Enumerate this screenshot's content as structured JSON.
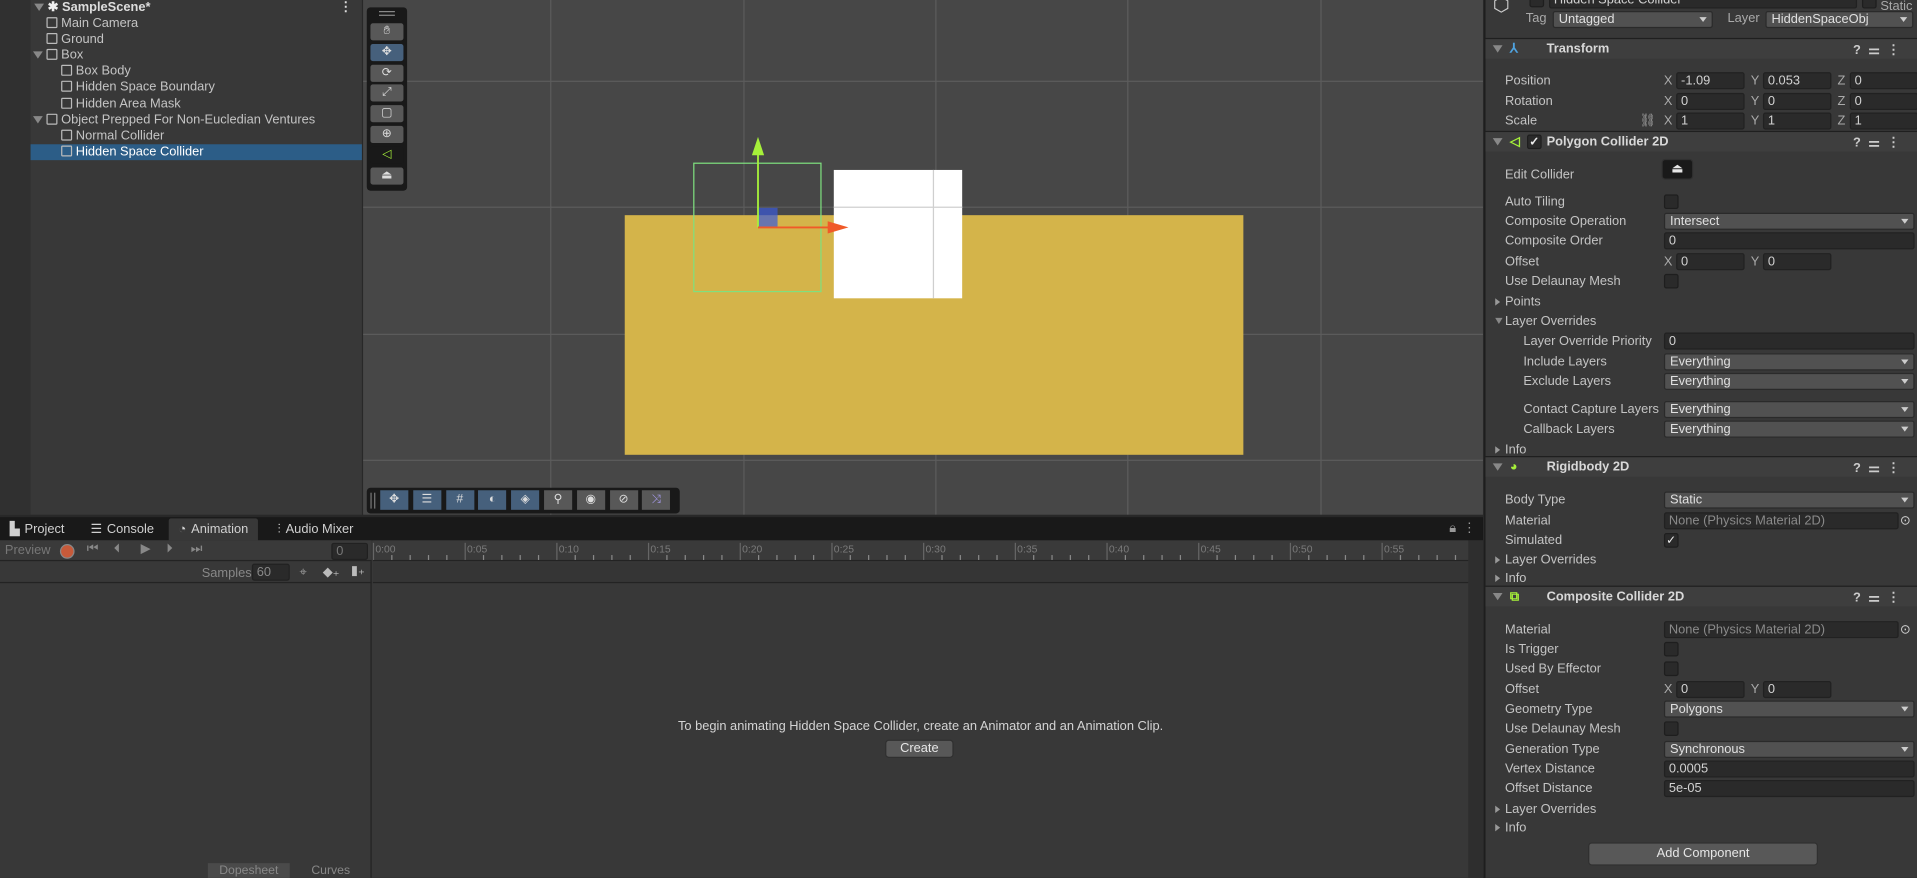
{
  "hierarchy": {
    "scene": "SampleScene*",
    "items": [
      {
        "label": "Main Camera",
        "depth": 1,
        "expanded": null
      },
      {
        "label": "Ground",
        "depth": 1,
        "expanded": null
      },
      {
        "label": "Box",
        "depth": 1,
        "expanded": true
      },
      {
        "label": "Box Body",
        "depth": 2,
        "expanded": null
      },
      {
        "label": "Hidden Space Boundary",
        "depth": 2,
        "expanded": null
      },
      {
        "label": "Hidden Area Mask",
        "depth": 2,
        "expanded": null
      },
      {
        "label": "Object Prepped For Non-Eucledian Ventures",
        "depth": 1,
        "expanded": true
      },
      {
        "label": "Normal Collider",
        "depth": 2,
        "expanded": null
      },
      {
        "label": "Hidden Space Collider",
        "depth": 2,
        "expanded": null,
        "selected": true
      }
    ]
  },
  "scene": {
    "tool_icons": [
      "hand-tool-icon",
      "move-tool-icon",
      "rotate-tool-icon",
      "scale-tool-icon",
      "rect-tool-icon",
      "transform-tool-icon",
      "edit-collider-tool-icon",
      "custom-tool-icon"
    ],
    "active_tool": "move-tool-icon",
    "overlay_icons": [
      "move-icon",
      "toolbar-settings-icon",
      "grid-icon",
      "lighting-icon",
      "gizmos-icon",
      "search-icon",
      "camera-visibility-icon",
      "orientation-icon",
      "fx-toggle-icon"
    ],
    "colors": {
      "ground": "#d4b44a",
      "box": "#ffffff",
      "collider_outline": "#7fe07f",
      "y_axis": "#a6f03a",
      "x_axis": "#f05a28"
    }
  },
  "bottom": {
    "tabs": [
      {
        "label": "Project",
        "icon": "folder-icon"
      },
      {
        "label": "Console",
        "icon": "console-icon"
      },
      {
        "label": "Animation",
        "icon": "clock-icon",
        "active": true
      },
      {
        "label": "Audio Mixer",
        "icon": "mixer-icon"
      }
    ],
    "preview_label": "Preview",
    "frame": "0",
    "samples_label": "Samples",
    "samples": "60",
    "timeline": [
      "0:00",
      "0:05",
      "0:10",
      "0:15",
      "0:20",
      "0:25",
      "0:30",
      "0:35",
      "0:40",
      "0:45",
      "0:50",
      "0:55"
    ],
    "message": "To begin animating Hidden Space Collider, create an Animator and an Animation Clip.",
    "create_label": "Create",
    "dopesheet_label": "Dopesheet",
    "curves_label": "Curves"
  },
  "inspector": {
    "object_name": "Hidden Space Collider",
    "static_label": "Static",
    "tag_label": "Tag",
    "tag": "Untagged",
    "layer_label": "Layer",
    "layer": "HiddenSpaceObj",
    "components": [
      {
        "title": "Transform",
        "icon": "transform-icon",
        "rows": [
          {
            "label": "Position",
            "kind": "xyz",
            "x": "-1.09",
            "y": "0.053",
            "z": "0"
          },
          {
            "label": "Rotation",
            "kind": "xyz",
            "x": "0",
            "y": "0",
            "z": "0"
          },
          {
            "label": "Scale",
            "kind": "xyz",
            "x": "1",
            "y": "1",
            "z": "1",
            "link": true
          }
        ]
      },
      {
        "title": "Polygon Collider 2D",
        "icon": "polygon-collider-icon",
        "enabled": true,
        "rows": [
          {
            "label": "Edit Collider",
            "kind": "editbtn"
          },
          {
            "label": "Auto Tiling",
            "kind": "check",
            "value": false
          },
          {
            "label": "Composite Operation",
            "kind": "dropdown",
            "value": "Intersect"
          },
          {
            "label": "Composite Order",
            "kind": "field",
            "value": "0"
          },
          {
            "label": "Offset",
            "kind": "xy",
            "x": "0",
            "y": "0"
          },
          {
            "label": "Use Delaunay Mesh",
            "kind": "check",
            "value": false
          },
          {
            "label": "Points",
            "kind": "fold",
            "expanded": false
          },
          {
            "label": "Layer Overrides",
            "kind": "fold",
            "expanded": true
          },
          {
            "label": "Layer Override Priority",
            "kind": "field",
            "value": "0",
            "indent": true
          },
          {
            "label": "Include Layers",
            "kind": "dropdown",
            "value": "Everything",
            "indent": true
          },
          {
            "label": "Exclude Layers",
            "kind": "dropdown",
            "value": "Everything",
            "indent": true
          },
          {
            "label": "Contact Capture Layers",
            "kind": "dropdown",
            "value": "Everything",
            "indent": true
          },
          {
            "label": "Callback Layers",
            "kind": "dropdown",
            "value": "Everything",
            "indent": true
          },
          {
            "label": "Info",
            "kind": "fold",
            "expanded": false
          }
        ]
      },
      {
        "title": "Rigidbody 2D",
        "icon": "rigidbody-icon",
        "rows": [
          {
            "label": "Body Type",
            "kind": "dropdown",
            "value": "Static"
          },
          {
            "label": "Material",
            "kind": "object",
            "value": "None (Physics Material 2D)"
          },
          {
            "label": "Simulated",
            "kind": "check",
            "value": true
          },
          {
            "label": "Layer Overrides",
            "kind": "fold",
            "expanded": false
          },
          {
            "label": "Info",
            "kind": "fold",
            "expanded": false
          }
        ]
      },
      {
        "title": "Composite Collider 2D",
        "icon": "composite-collider-icon",
        "rows": [
          {
            "label": "Material",
            "kind": "object",
            "value": "None (Physics Material 2D)"
          },
          {
            "label": "Is Trigger",
            "kind": "check",
            "value": false
          },
          {
            "label": "Used By Effector",
            "kind": "check",
            "value": false
          },
          {
            "label": "Offset",
            "kind": "xy",
            "x": "0",
            "y": "0"
          },
          {
            "label": "Geometry Type",
            "kind": "dropdown",
            "value": "Polygons"
          },
          {
            "label": "Use Delaunay Mesh",
            "kind": "check",
            "value": false
          },
          {
            "label": "Generation Type",
            "kind": "dropdown",
            "value": "Synchronous"
          },
          {
            "label": "Vertex Distance",
            "kind": "field",
            "value": "0.0005"
          },
          {
            "label": "Offset Distance",
            "kind": "field",
            "value": "5e-05"
          },
          {
            "label": "Layer Overrides",
            "kind": "fold",
            "expanded": false
          },
          {
            "label": "Info",
            "kind": "fold",
            "expanded": false
          }
        ]
      }
    ],
    "add_component_label": "Add Component"
  }
}
